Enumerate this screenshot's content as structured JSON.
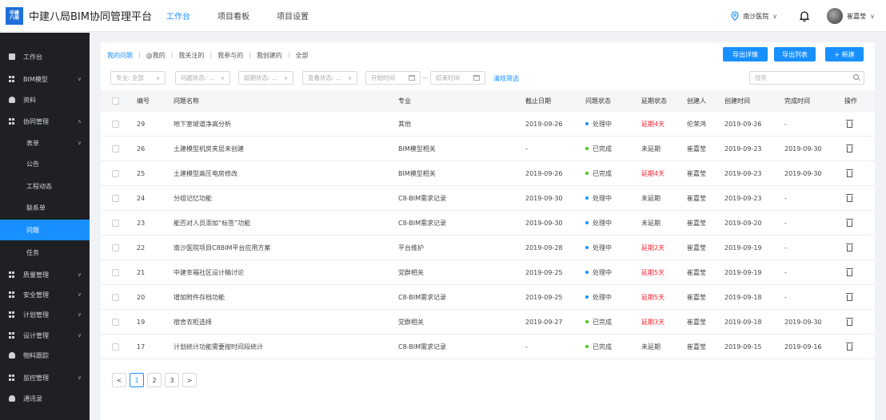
{
  "header": {
    "logo_text": "中建八局",
    "title": "中建八局BIM协同管理平台",
    "nav": [
      {
        "label": "工作台",
        "active": true
      },
      {
        "label": "项目看板",
        "active": false
      },
      {
        "label": "项目设置",
        "active": false
      }
    ],
    "location": "南沙医院",
    "user": "崔嘉莹"
  },
  "sidebar": {
    "items": [
      {
        "label": "工作台",
        "icon": "monitor-icon"
      },
      {
        "label": "BIM模型",
        "icon": "grid-icon",
        "expandable": true
      },
      {
        "label": "资料",
        "icon": "person-icon"
      },
      {
        "label": "协同管理",
        "icon": "grid-icon",
        "expanded": true
      },
      {
        "label": "质量管理",
        "icon": "grid-icon",
        "expandable": true
      },
      {
        "label": "安全管理",
        "icon": "grid-icon",
        "expandable": true
      },
      {
        "label": "计划管理",
        "icon": "grid-icon",
        "expandable": true
      },
      {
        "label": "设计管理",
        "icon": "grid-icon",
        "expandable": true
      },
      {
        "label": "物料跟踪",
        "icon": "person-icon"
      },
      {
        "label": "监控管理",
        "icon": "grid-icon",
        "expandable": true
      },
      {
        "label": "通讯录",
        "icon": "contacts-icon"
      }
    ],
    "sub_items": [
      {
        "label": "表单",
        "expandable": true
      },
      {
        "label": "公告"
      },
      {
        "label": "工程动态"
      },
      {
        "label": "联系单"
      },
      {
        "label": "问题",
        "active": true
      },
      {
        "label": "任务"
      }
    ]
  },
  "filters": {
    "tabs": [
      {
        "label": "我的问题",
        "active": true
      },
      {
        "label": "@我的"
      },
      {
        "label": "我关注的"
      },
      {
        "label": "我参与的"
      },
      {
        "label": "我创建的"
      },
      {
        "label": "全部"
      }
    ],
    "separator": "|",
    "selects": [
      "专业: 全部",
      "问题状态: ...",
      "延期状态: ...",
      "查看状态: ..."
    ],
    "start_date": "开始时间",
    "end_date": "结束时间",
    "date_sep": "—",
    "clear": "清除筛选",
    "search_placeholder": "搜索"
  },
  "actions": {
    "export_detail": "导出详情",
    "export_list": "导出列表",
    "new": "+ 新建"
  },
  "table": {
    "columns": [
      "编号",
      "问题名称",
      "专业",
      "截止日期",
      "问题状态",
      "延期状态",
      "创建人",
      "创建时间",
      "完成时间",
      "操作"
    ],
    "rows": [
      {
        "id": "29",
        "name": "地下室坡道净高分析",
        "discipline": "其他",
        "deadline": "2019-09-26",
        "status": "处理中",
        "status_color": "#1890ff",
        "delay": "延期4天",
        "delayed": true,
        "creator": "伦荣鸿",
        "created": "2019-09-26",
        "done": "-"
      },
      {
        "id": "26",
        "name": "土建模型机房夹层未创建",
        "discipline": "BIM模型相关",
        "deadline": "-",
        "status": "已完成",
        "status_color": "#52c41a",
        "delay": "未延期",
        "delayed": false,
        "creator": "崔嘉莹",
        "created": "2019-09-23",
        "done": "2019-09-30"
      },
      {
        "id": "25",
        "name": "土建模型高压电房修改",
        "discipline": "BIM模型相关",
        "deadline": "2019-09-26",
        "status": "已完成",
        "status_color": "#52c41a",
        "delay": "延期4天",
        "delayed": true,
        "creator": "崔嘉莹",
        "created": "2019-09-23",
        "done": "2019-09-30"
      },
      {
        "id": "24",
        "name": "分组记忆功能",
        "discipline": "C8-BIM需求记录",
        "deadline": "2019-09-30",
        "status": "处理中",
        "status_color": "#1890ff",
        "delay": "未延期",
        "delayed": false,
        "creator": "崔嘉莹",
        "created": "2019-09-23",
        "done": "-"
      },
      {
        "id": "23",
        "name": "能否对人员添加“标签”功能",
        "discipline": "C8-BIM需求记录",
        "deadline": "2019-09-30",
        "status": "处理中",
        "status_color": "#1890ff",
        "delay": "未延期",
        "delayed": false,
        "creator": "崔嘉莹",
        "created": "2019-09-20",
        "done": "-"
      },
      {
        "id": "22",
        "name": "南沙医院项目C8BIM平台应用方案",
        "discipline": "平台维护",
        "deadline": "2019-09-28",
        "status": "处理中",
        "status_color": "#1890ff",
        "delay": "延期2天",
        "delayed": true,
        "creator": "崔嘉莹",
        "created": "2019-09-19",
        "done": "-"
      },
      {
        "id": "21",
        "name": "中建幸福社区设计稿讨论",
        "discipline": "党群相关",
        "deadline": "2019-09-25",
        "status": "处理中",
        "status_color": "#1890ff",
        "delay": "延期5天",
        "delayed": true,
        "creator": "崔嘉莹",
        "created": "2019-09-19",
        "done": "-"
      },
      {
        "id": "20",
        "name": "增加附件存档功能",
        "discipline": "C8-BIM需求记录",
        "deadline": "2019-09-25",
        "status": "处理中",
        "status_color": "#1890ff",
        "delay": "延期5天",
        "delayed": true,
        "creator": "崔嘉莹",
        "created": "2019-09-18",
        "done": "-"
      },
      {
        "id": "19",
        "name": "宿舍衣柜选择",
        "discipline": "党群相关",
        "deadline": "2019-09-27",
        "status": "已完成",
        "status_color": "#52c41a",
        "delay": "延期3天",
        "delayed": true,
        "creator": "崔嘉莹",
        "created": "2019-09-18",
        "done": "2019-09-30"
      },
      {
        "id": "17",
        "name": "计划统计功能需要按时间段统计",
        "discipline": "C8-BIM需求记录",
        "deadline": "-",
        "status": "已完成",
        "status_color": "#52c41a",
        "delay": "未延期",
        "delayed": false,
        "creator": "崔嘉莹",
        "created": "2019-09-15",
        "done": "2019-09-16"
      }
    ]
  },
  "pagination": {
    "prev": "<",
    "next": ">",
    "pages": [
      "1",
      "2",
      "3"
    ],
    "current": "1"
  },
  "colors": {
    "accent": "#1890ff",
    "sidebar_bg": "#1e2024",
    "delay_red": "#f5222d",
    "done_green": "#52c41a"
  }
}
